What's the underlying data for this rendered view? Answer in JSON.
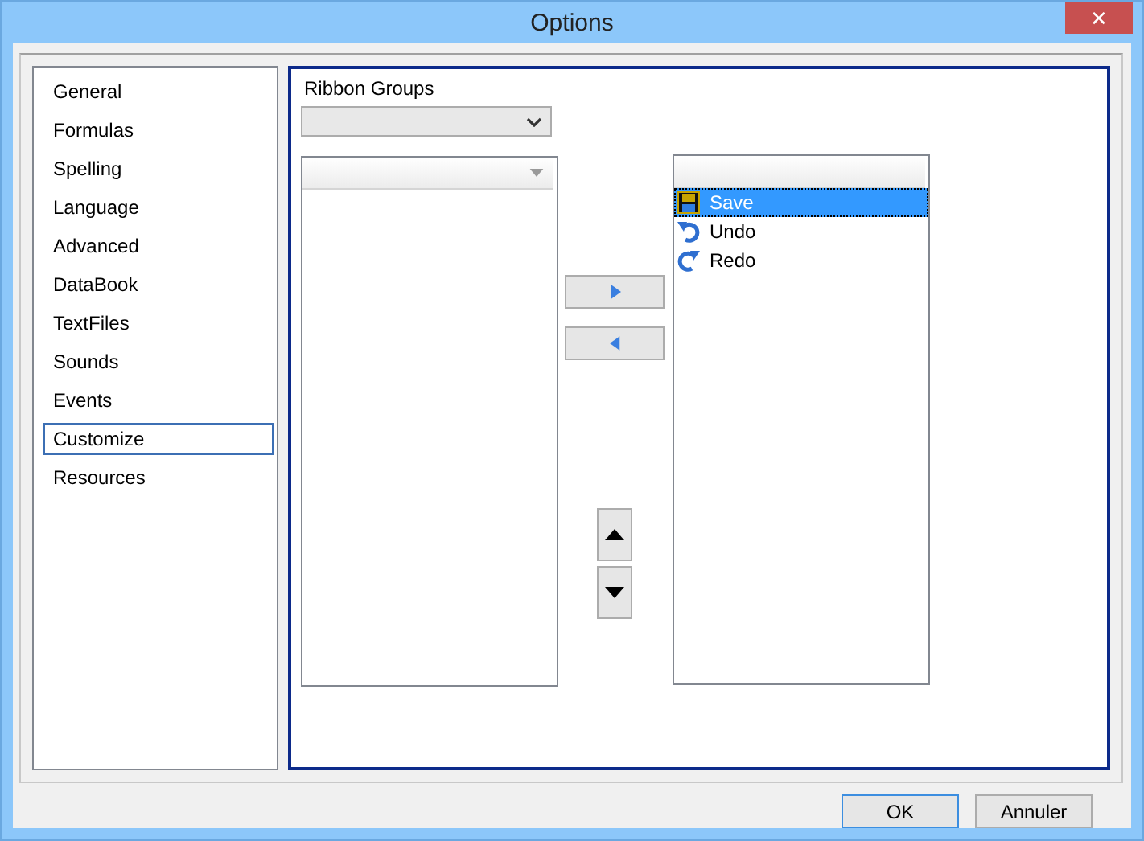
{
  "window": {
    "title": "Options",
    "close": "✕"
  },
  "nav": [
    {
      "label": "General",
      "selected": false
    },
    {
      "label": "Formulas",
      "selected": false
    },
    {
      "label": "Spelling",
      "selected": false
    },
    {
      "label": "Language",
      "selected": false
    },
    {
      "label": "Advanced",
      "selected": false
    },
    {
      "label": "DataBook",
      "selected": false
    },
    {
      "label": "TextFiles",
      "selected": false
    },
    {
      "label": "Sounds",
      "selected": false
    },
    {
      "label": "Events",
      "selected": false
    },
    {
      "label": "Customize",
      "selected": true
    },
    {
      "label": "Resources",
      "selected": false
    }
  ],
  "ribbon_groups": {
    "label": "Ribbon Groups",
    "dropdown": {
      "disabled": true
    }
  },
  "commands": [
    {
      "label": "Save",
      "kind": "save",
      "selected": true
    },
    {
      "label": "Undo",
      "kind": "undo",
      "selected": false
    },
    {
      "label": "Redo",
      "kind": "redo",
      "selected": false
    }
  ],
  "buttons": [
    {
      "label": "OK",
      "default": true
    },
    {
      "label": "Annuler",
      "default": false
    }
  ]
}
